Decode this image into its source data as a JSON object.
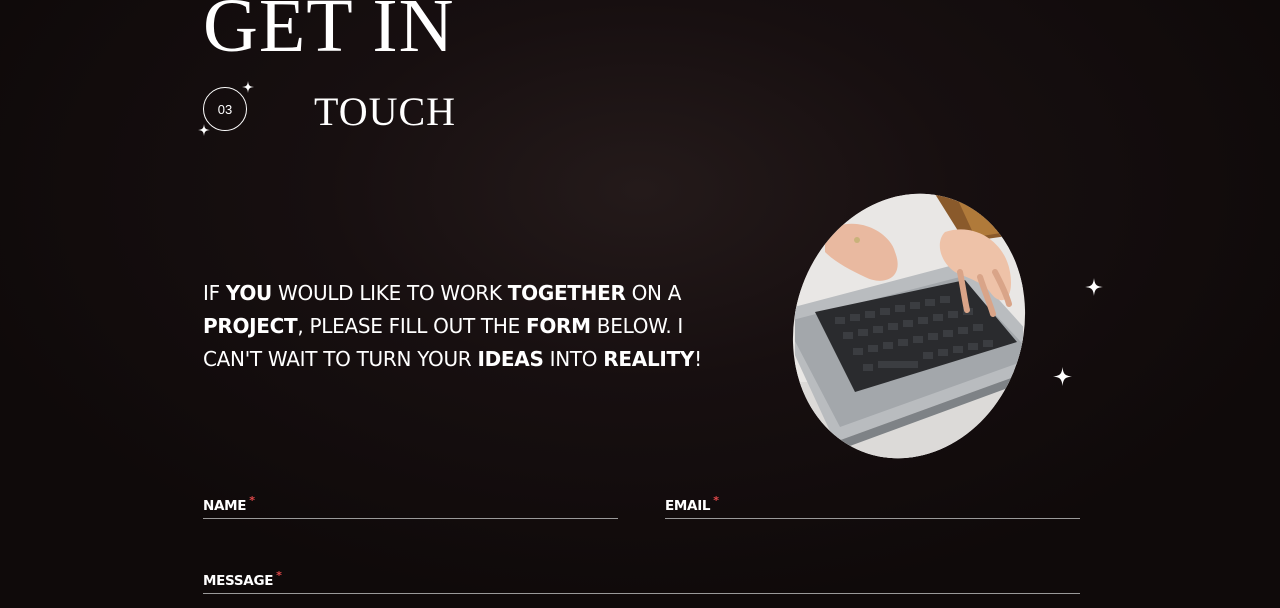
{
  "hero": {
    "title_line1": "GET IN",
    "title_line2": "TOUCH",
    "section_number": "03"
  },
  "intro": {
    "parts": [
      {
        "text": "IF ",
        "bold": false
      },
      {
        "text": "YOU",
        "bold": true
      },
      {
        "text": " WOULD LIKE TO WORK ",
        "bold": false
      },
      {
        "text": "TOGETHER",
        "bold": true
      },
      {
        "text": " ON A ",
        "bold": false
      },
      {
        "text": "PROJECT",
        "bold": true
      },
      {
        "text": ", PLEASE FILL OUT THE ",
        "bold": false
      },
      {
        "text": "FORM",
        "bold": true
      },
      {
        "text": " BELOW. I CAN'T WAIT TO TURN YOUR ",
        "bold": false
      },
      {
        "text": "IDEAS",
        "bold": true
      },
      {
        "text": " INTO ",
        "bold": false
      },
      {
        "text": "REALITY",
        "bold": true
      },
      {
        "text": "!",
        "bold": false
      }
    ]
  },
  "form": {
    "name_label": "NAME",
    "email_label": "EMAIL",
    "message_label": "MESSAGE",
    "required_mark": "*",
    "name_value": "",
    "email_value": "",
    "message_value": ""
  },
  "icons": {
    "sparkle": "four-point-star-icon",
    "photo": "laptop-typing-photo"
  },
  "colors": {
    "background": "#110b0b",
    "text": "#ffffff",
    "required": "#e0494a",
    "underline": "#9a9a9a"
  }
}
